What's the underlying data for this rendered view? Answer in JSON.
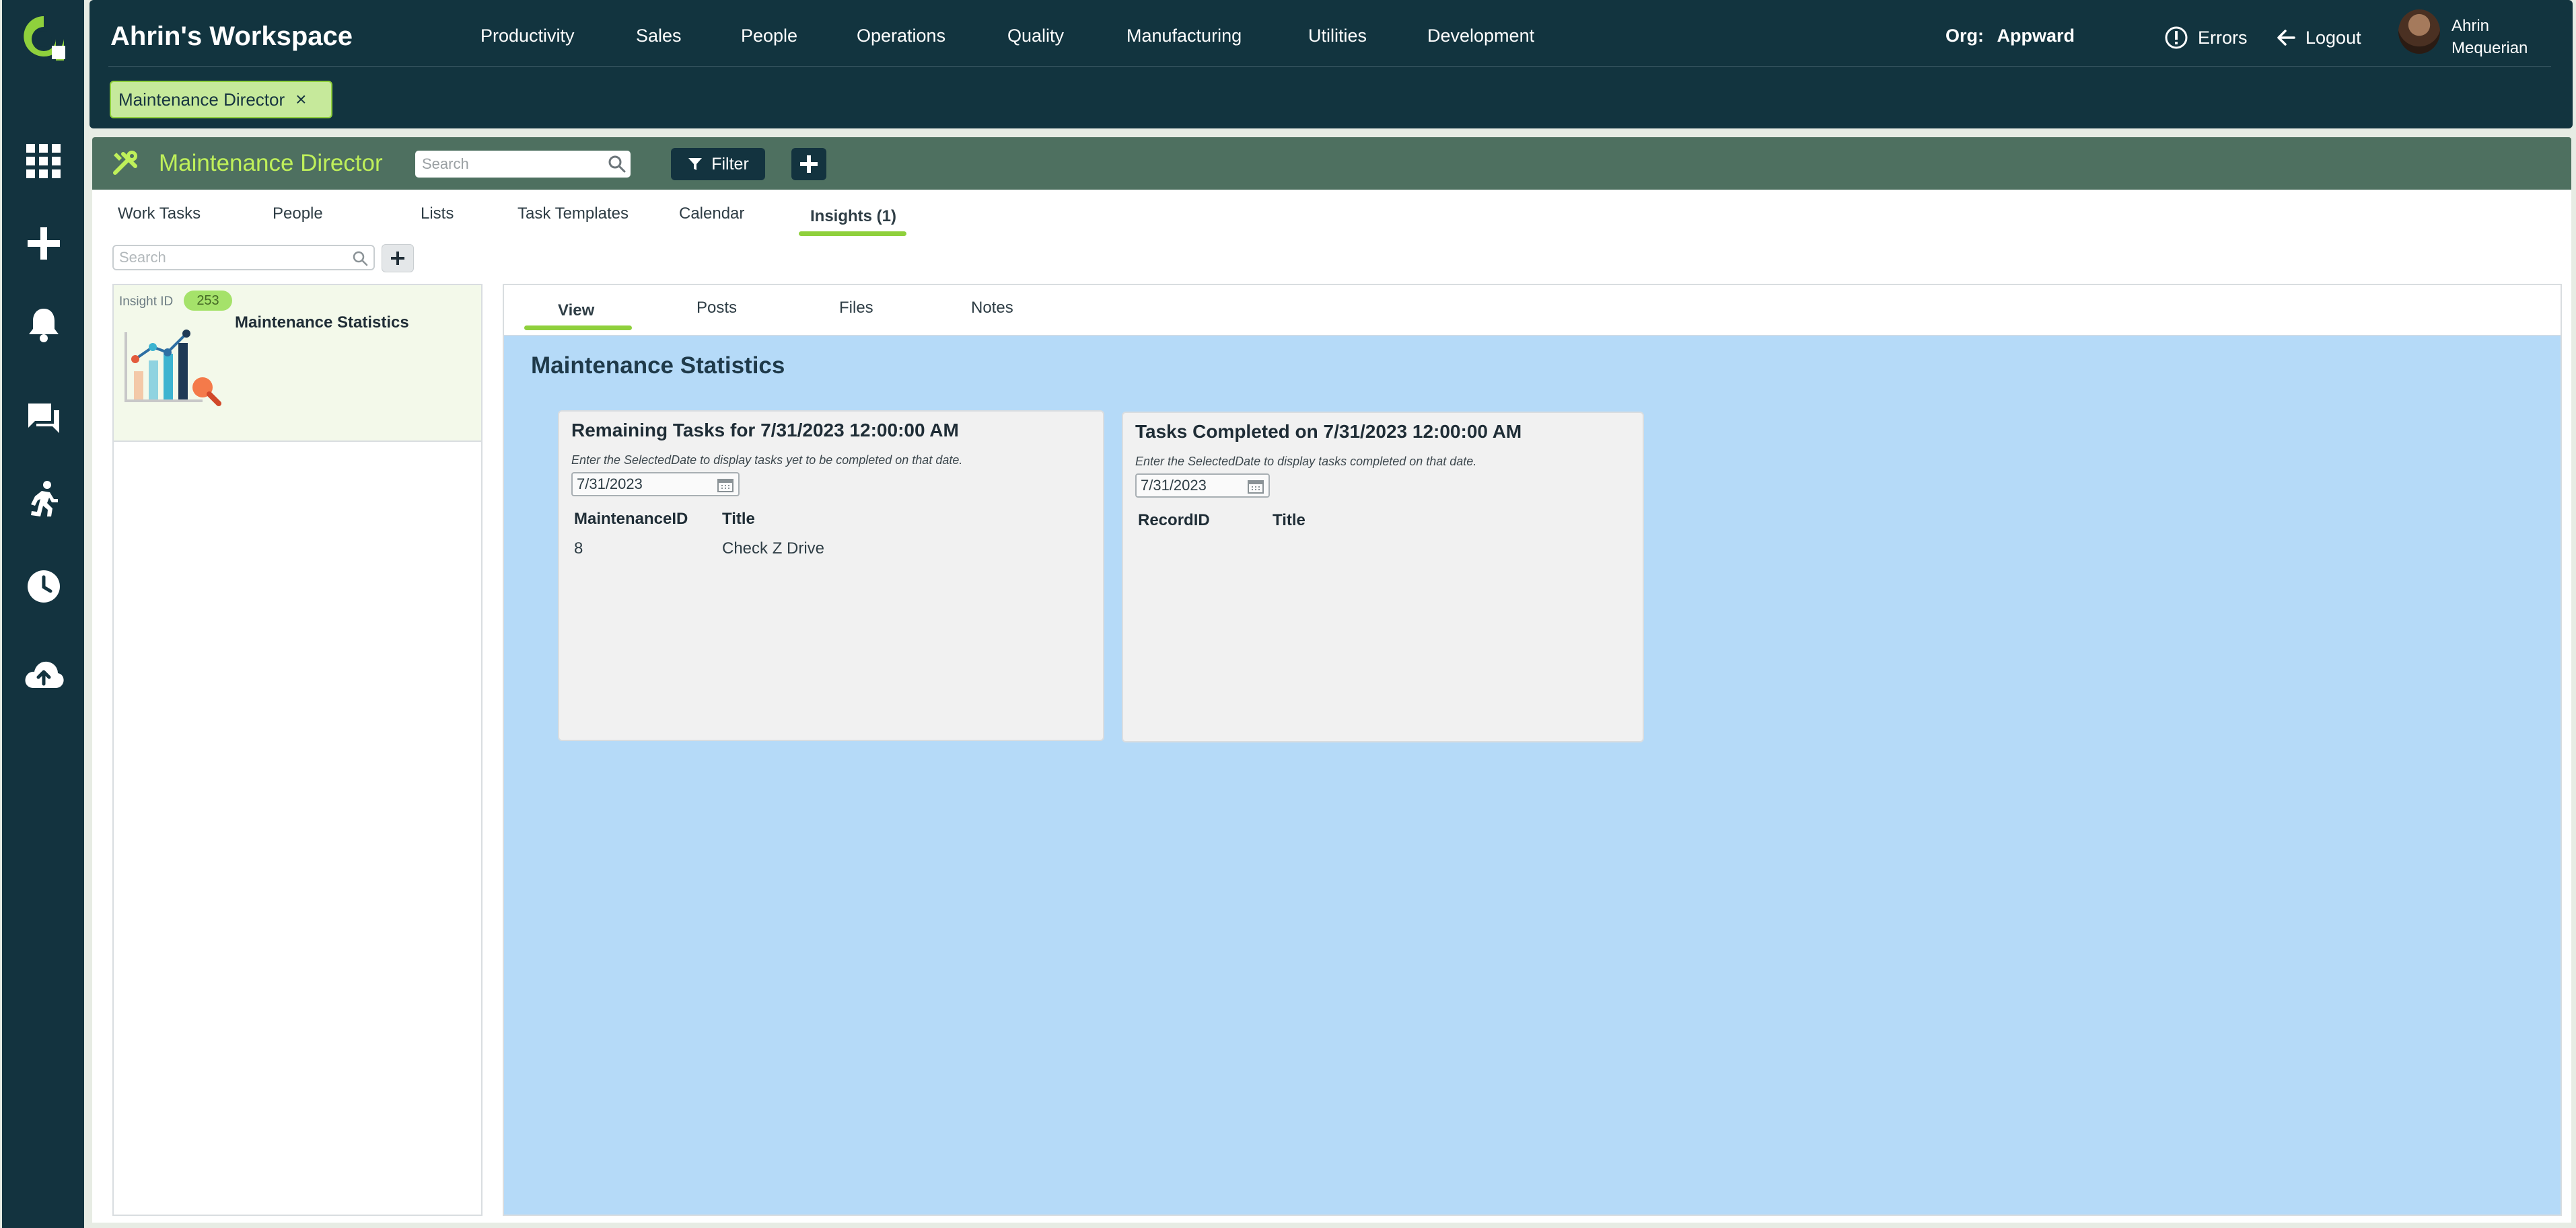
{
  "workspace": {
    "title": "Ahrin's Workspace"
  },
  "nav": [
    "Productivity",
    "Sales",
    "People",
    "Operations",
    "Quality",
    "Manufacturing",
    "Utilities",
    "Development"
  ],
  "org": {
    "label": "Org:",
    "value": "Appward"
  },
  "header_links": {
    "errors": "Errors",
    "logout": "Logout"
  },
  "user": {
    "first": "Ahrin",
    "last": "Mequerian"
  },
  "open_tag": {
    "label": "Maintenance Director",
    "close": "×"
  },
  "rail_icons": [
    "apps-grid-icon",
    "plus-icon",
    "bell-icon",
    "chat-icon",
    "running-person-icon",
    "clock-icon",
    "cloud-upload-icon"
  ],
  "app": {
    "title": "Maintenance Director",
    "search_placeholder": "Search",
    "filter_label": "Filter"
  },
  "tabs": [
    "Work Tasks",
    "People",
    "Lists",
    "Task Templates",
    "Calendar",
    "Insights (1)"
  ],
  "active_tab": "Insights (1)",
  "list": {
    "search_placeholder": "Search",
    "item": {
      "id_label": "Insight ID",
      "id": "253",
      "name": "Maintenance Statistics"
    }
  },
  "detail": {
    "tabs": [
      "View",
      "Posts",
      "Files",
      "Notes"
    ],
    "active_tab": "View",
    "title": "Maintenance Statistics",
    "cards": [
      {
        "title": "Remaining Tasks for 7/31/2023 12:00:00 AM",
        "help": "Enter the SelectedDate to display tasks yet to be completed on that date.",
        "date": "7/31/2023",
        "columns": [
          "MaintenanceID",
          "Title"
        ],
        "rows": [
          [
            "8",
            "Check Z Drive"
          ]
        ]
      },
      {
        "title": "Tasks Completed on 7/31/2023 12:00:00 AM",
        "help": "Enter the SelectedDate to display tasks completed on that date.",
        "date": "7/31/2023",
        "columns": [
          "RecordID",
          "Title"
        ],
        "rows": []
      }
    ]
  },
  "colors": {
    "rail": "#13333f",
    "header": "#12343f",
    "appbar": "#4e7060",
    "accent": "#8fd03c",
    "app_title": "#bff05a",
    "detail_bg": "#b5daf8",
    "card_bg": "#f1f1f1"
  }
}
